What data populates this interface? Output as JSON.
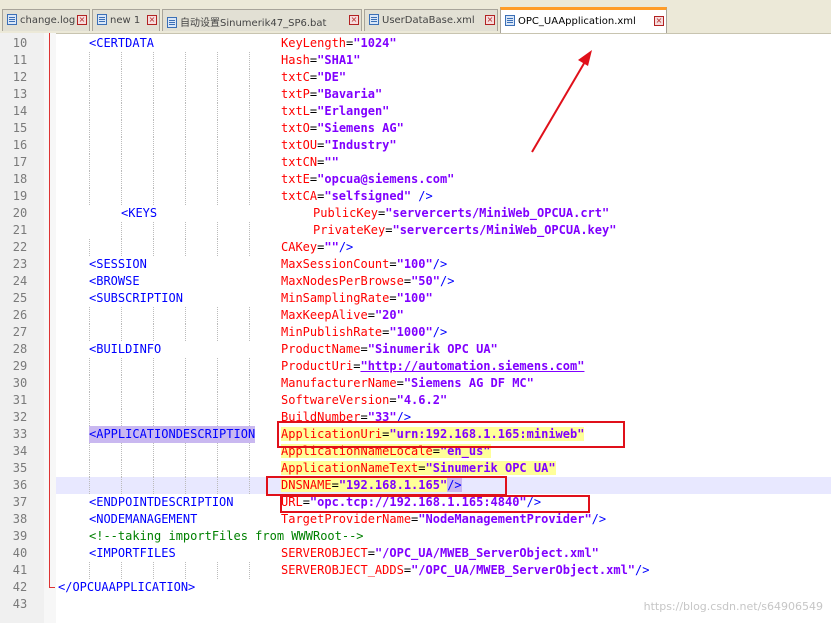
{
  "tabs": [
    {
      "label": "change.log",
      "active": false
    },
    {
      "label": "new 1",
      "active": false
    },
    {
      "label": "自动设置Sinumerik47_SP6.bat",
      "active": false
    },
    {
      "label": "UserDataBase.xml",
      "active": false
    },
    {
      "label": "OPC_UAApplication.xml",
      "active": true
    }
  ],
  "lines": [
    {
      "n": "10",
      "tag": "<CERTDATA",
      "attr": "KeyLength",
      "val": "\"1024\""
    },
    {
      "n": "11",
      "attr": "Hash",
      "val": "\"SHA1\""
    },
    {
      "n": "12",
      "attr": "txtC",
      "val": "\"DE\""
    },
    {
      "n": "13",
      "attr": "txtP",
      "val": "\"Bavaria\""
    },
    {
      "n": "14",
      "attr": "txtL",
      "val": "\"Erlangen\""
    },
    {
      "n": "15",
      "attr": "txtO",
      "val": "\"Siemens AG\""
    },
    {
      "n": "16",
      "attr": "txtOU",
      "val": "\"Industry\""
    },
    {
      "n": "17",
      "attr": "txtCN",
      "val": "\"\""
    },
    {
      "n": "18",
      "attr": "txtE",
      "val": "\"opcua@siemens.com\""
    },
    {
      "n": "19",
      "attr": "txtCA",
      "val": "\"selfsigned\"",
      "tail": " />"
    },
    {
      "n": "20",
      "tag": "<KEYS",
      "attr": "PublicKey",
      "val": "\"servercerts/MiniWeb_OPCUA.crt\"",
      "deep": true
    },
    {
      "n": "21",
      "attr": "PrivateKey",
      "val": "\"servercerts/MiniWeb_OPCUA.key\"",
      "deep": true
    },
    {
      "n": "22",
      "attr": "CAKey",
      "val": "\"\"",
      "tail": "/>"
    },
    {
      "n": "23",
      "tag": "<SESSION",
      "attr": "MaxSessionCount",
      "val": "\"100\"",
      "tail": "/>"
    },
    {
      "n": "24",
      "tag": "<BROWSE",
      "attr": "MaxNodesPerBrowse",
      "val": "\"50\"",
      "tail": "/>"
    },
    {
      "n": "25",
      "tag": "<SUBSCRIPTION",
      "attr": "MinSamplingRate",
      "val": "\"100\""
    },
    {
      "n": "26",
      "attr": "MaxKeepAlive",
      "val": "\"20\""
    },
    {
      "n": "27",
      "attr": "MinPublishRate",
      "val": "\"1000\"",
      "tail": "/>"
    },
    {
      "n": "28",
      "tag": "<BUILDINFO",
      "attr": "ProductName",
      "val": "\"Sinumerik OPC UA\""
    },
    {
      "n": "29",
      "attr": "ProductUri",
      "val": "\"http://automation.siemens.com\"",
      "link": true
    },
    {
      "n": "30",
      "attr": "ManufacturerName",
      "val": "\"Siemens AG DF MC\""
    },
    {
      "n": "31",
      "attr": "SoftwareVersion",
      "val": "\"4.6.2\""
    },
    {
      "n": "32",
      "attr": "BuildNumber",
      "val": "\"33\"",
      "tail": "/>"
    },
    {
      "n": "33",
      "tag": "<APPLICATIONDESCRIPTION",
      "tagHl": true,
      "attr": "ApplicationUri",
      "val": "\"urn:192.168.1.165:miniweb\"",
      "attrHl": true
    },
    {
      "n": "34",
      "attr": "ApplicationNameLocale",
      "val": "\"en_us\"",
      "attrHl": true
    },
    {
      "n": "35",
      "attr": "ApplicationNameText",
      "val": "\"Sinumerik OPC UA\"",
      "attrHl": true
    },
    {
      "n": "36",
      "attr": "DNSNAME",
      "val": "\"192.168.1.165\"",
      "tail": "/>",
      "attrHl": true,
      "current": true
    },
    {
      "n": "37",
      "tag": "<ENDPOINTDESCRIPTION",
      "attr": "URL",
      "val": "\"opc.tcp://192.168.1.165:4840\"",
      "tail": "/>"
    },
    {
      "n": "38",
      "tag": "<NODEMANAGEMENT",
      "attr": "TargetProviderName",
      "val": "\"NodeManagementProvider\"",
      "tail": "/>"
    },
    {
      "n": "39",
      "comment": "<!--taking importFiles from WWWRoot-->"
    },
    {
      "n": "40",
      "tag": "<IMPORTFILES",
      "attr": "SERVEROBJECT",
      "val": "\"/OPC_UA/MWEB_ServerObject.xml\""
    },
    {
      "n": "41",
      "attr": "SERVEROBJECT_ADDS",
      "val": "\"/OPC_UA/MWEB_ServerObject.xml\"",
      "tail": "/>"
    },
    {
      "n": "42",
      "close": "</OPCUAAPPLICATION>"
    },
    {
      "n": "43"
    }
  ],
  "watermark": "https://blog.csdn.net/s64906549",
  "colors": {
    "tag": "#0000ff",
    "attribute": "#ff0000",
    "value": "#8000ff",
    "comment": "#008000",
    "annotation": "#e0101a"
  }
}
